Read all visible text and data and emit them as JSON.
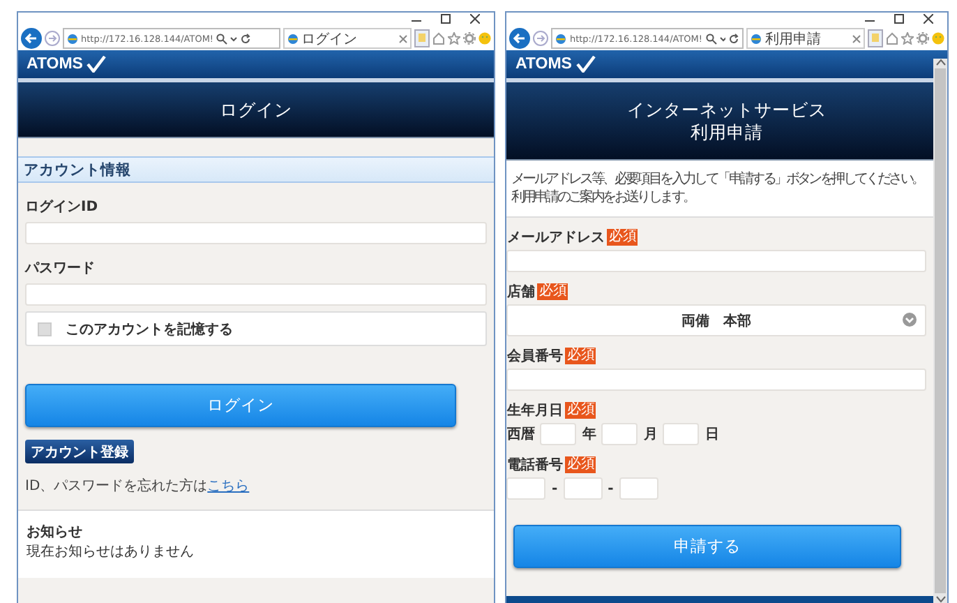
{
  "windows": [
    {
      "kind": "login",
      "address": "http://172.16.128.144/ATOM!",
      "tab_title": "ログイン",
      "logo": "ATOMS",
      "page_title": [
        "ログイン"
      ],
      "section_title": "アカウント情報",
      "fields": [
        {
          "label": "ログインID"
        },
        {
          "label": "パスワード"
        }
      ],
      "remember": {
        "label": "このアカウントを記憶する",
        "checked": false
      },
      "login_button": "ログイン",
      "register_button": "アカウント登録",
      "forgot_text": "ID、パスワードを忘れた方は",
      "forgot_link": "こちら",
      "notice": {
        "title": "お知らせ",
        "text": "現在お知らせはありません"
      }
    },
    {
      "kind": "apply",
      "address": "http://172.16.128.144/ATOM!",
      "tab_title": "利用申請",
      "logo": "ATOMS",
      "page_title": [
        "インターネットサービス",
        "利用申請"
      ],
      "description": [
        "メールアドレス等、必要項目を入力して「申請する」ボタンを押してください。",
        "利用申請のご案内をお送りします。"
      ],
      "email": {
        "label": "メールアドレス",
        "badge": "必須"
      },
      "store": {
        "label": "店舗",
        "badge": "必須",
        "value": "両備　本部"
      },
      "member": {
        "label": "会員番号",
        "badge": "必須"
      },
      "birth": {
        "label": "生年月日",
        "badge": "必須",
        "era": "西暦",
        "units": [
          "年",
          "月",
          "日"
        ]
      },
      "phone": {
        "label": "電話番号",
        "badge": "必須",
        "separators": [
          "-",
          "-"
        ]
      },
      "submit_button": "申請する"
    }
  ]
}
